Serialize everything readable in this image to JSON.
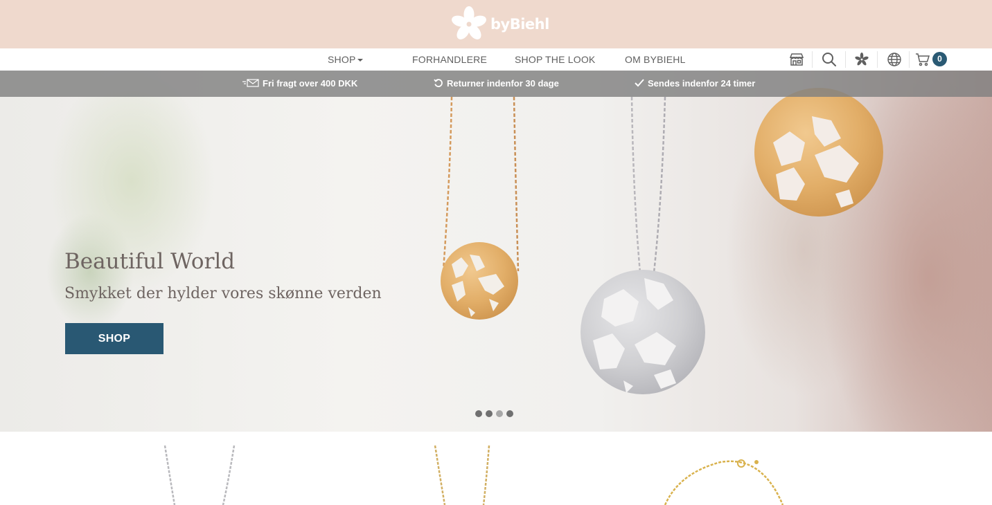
{
  "brand": {
    "logo_text": "byBiehl",
    "logo_icon": "flower-icon"
  },
  "nav": {
    "links": [
      {
        "label": "SHOP",
        "has_dropdown": true
      },
      {
        "label": "FORHANDLERE"
      },
      {
        "label": "SHOP THE LOOK"
      },
      {
        "label": "OM BYBIEHL"
      }
    ],
    "icons": [
      "store-icon",
      "search-icon",
      "flower-icon",
      "globe-icon",
      "cart-icon"
    ],
    "cart_count": "0"
  },
  "info_bar": [
    {
      "icon": "envelope-icon",
      "text": "Fri fragt over 400 DKK"
    },
    {
      "icon": "return-icon",
      "text": "Returner indenfor 30 dage"
    },
    {
      "icon": "check-icon",
      "text": "Sendes indenfor 24 timer"
    }
  ],
  "hero": {
    "title": "Beautiful World",
    "subtitle": "Smykket der hylder vores skønne verden",
    "button_label": "SHOP",
    "slides": 4,
    "active_slide": 3
  },
  "colors": {
    "brand_bar": "#efd9cd",
    "accent": "#295873",
    "badge": "#2a5a74",
    "gold": "#e0ae6a",
    "silver": "#c9c9cc"
  }
}
